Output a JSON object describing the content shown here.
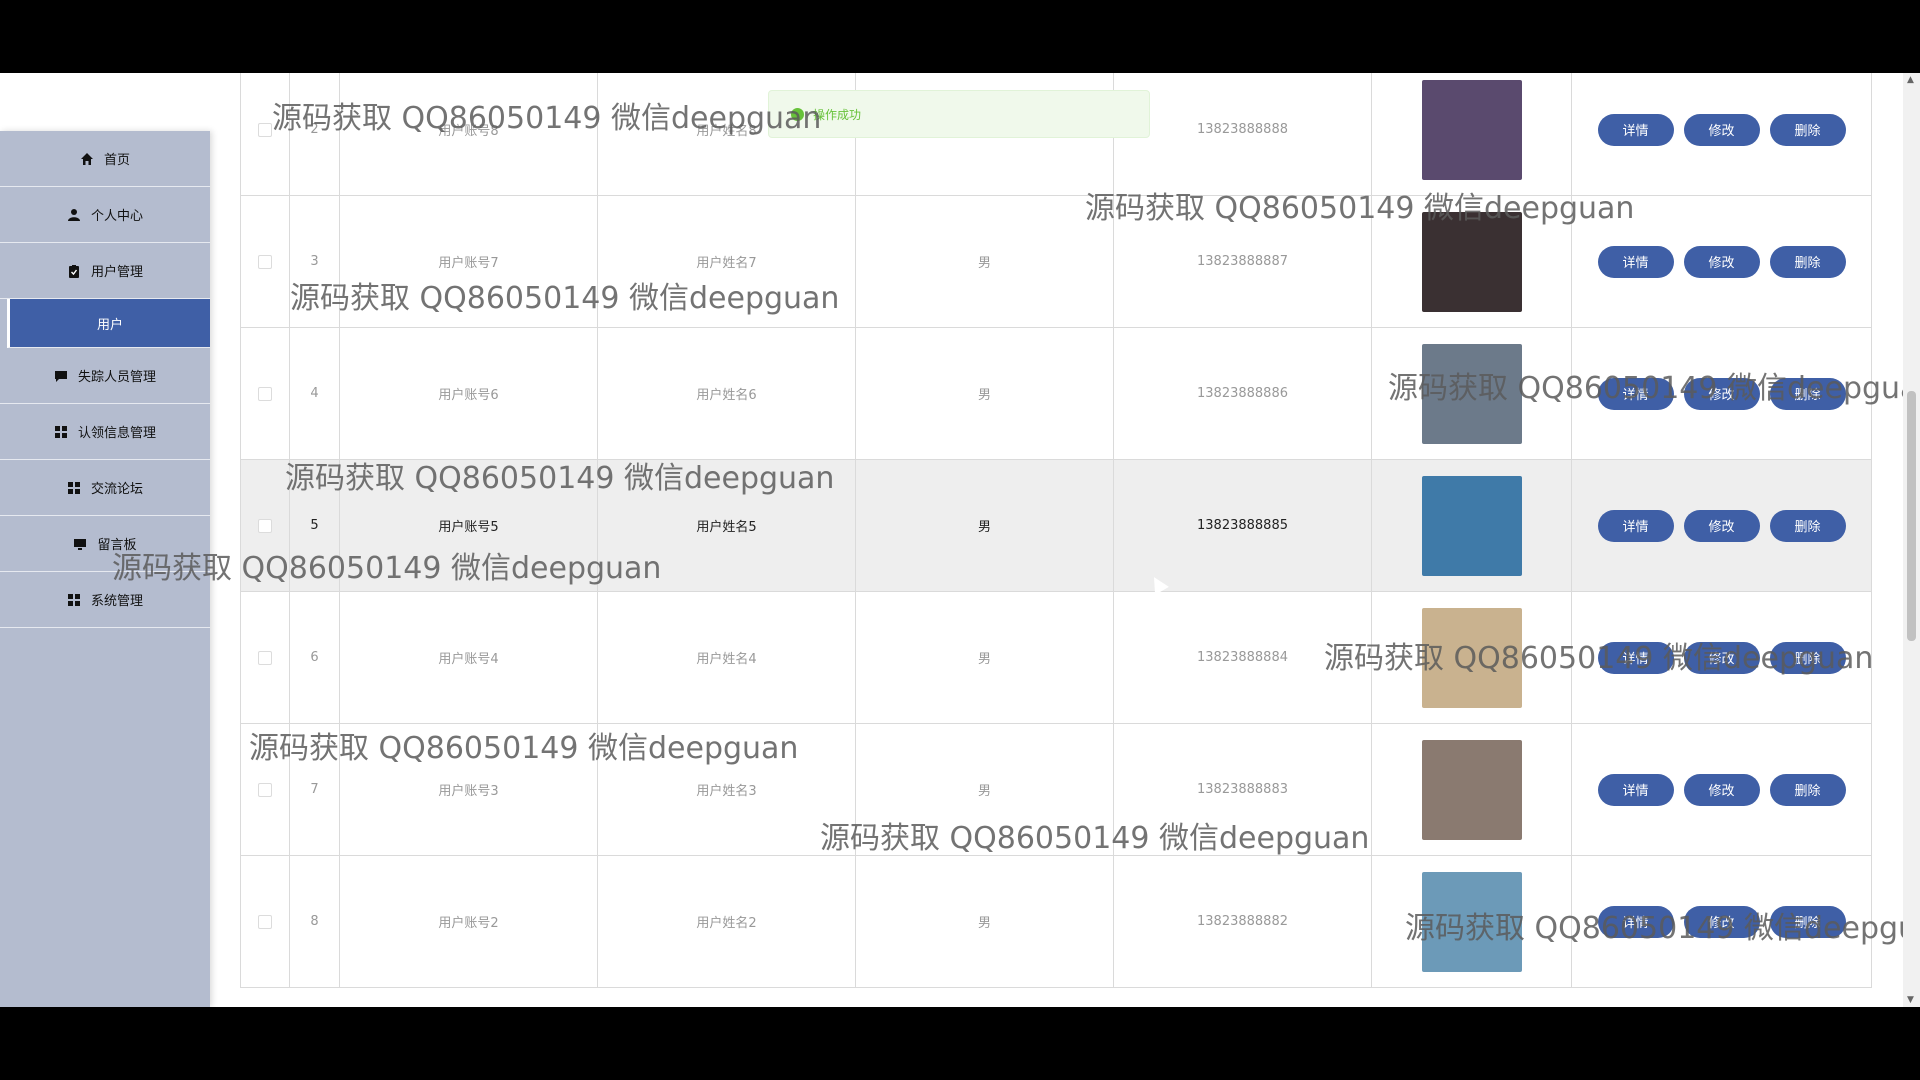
{
  "sidebar": {
    "items": [
      {
        "label": "首页",
        "icon": "home-icon"
      },
      {
        "label": "个人中心",
        "icon": "person-icon"
      },
      {
        "label": "用户管理",
        "icon": "clipboard-icon"
      },
      {
        "label": "用户",
        "icon": ""
      },
      {
        "label": "失踪人员管理",
        "icon": "chat-icon"
      },
      {
        "label": "认领信息管理",
        "icon": "grid-icon"
      },
      {
        "label": "交流论坛",
        "icon": "grid-icon"
      },
      {
        "label": "留言板",
        "icon": "monitor-icon"
      },
      {
        "label": "系统管理",
        "icon": "grid-icon"
      }
    ]
  },
  "toast": {
    "text": "操作成功"
  },
  "table": {
    "actions": {
      "detail": "详情",
      "edit": "修改",
      "delete": "删除"
    },
    "rows": [
      {
        "index": "2",
        "account": "用户账号8",
        "name": "用户姓名8",
        "sex": "",
        "phone": "13823888888",
        "photo_color": "#5a4a6e"
      },
      {
        "index": "3",
        "account": "用户账号7",
        "name": "用户姓名7",
        "sex": "男",
        "phone": "13823888887",
        "photo_color": "#3a3032"
      },
      {
        "index": "4",
        "account": "用户账号6",
        "name": "用户姓名6",
        "sex": "男",
        "phone": "13823888886",
        "photo_color": "#6c7a8a"
      },
      {
        "index": "5",
        "account": "用户账号5",
        "name": "用户姓名5",
        "sex": "男",
        "phone": "13823888885",
        "photo_color": "#3f7aa8"
      },
      {
        "index": "6",
        "account": "用户账号4",
        "name": "用户姓名4",
        "sex": "男",
        "phone": "13823888884",
        "photo_color": "#c9b28f"
      },
      {
        "index": "7",
        "account": "用户账号3",
        "name": "用户姓名3",
        "sex": "男",
        "phone": "13823888883",
        "photo_color": "#8a7a70"
      },
      {
        "index": "8",
        "account": "用户账号2",
        "name": "用户姓名2",
        "sex": "男",
        "phone": "13823888882",
        "photo_color": "#6c9ab8"
      }
    ]
  },
  "watermark": "源码获取 QQ86050149 微信deepguan",
  "colors": {
    "accent": "#3f5fa6",
    "sidebar_bg": "#b4bccf",
    "success": "#67c23a"
  }
}
